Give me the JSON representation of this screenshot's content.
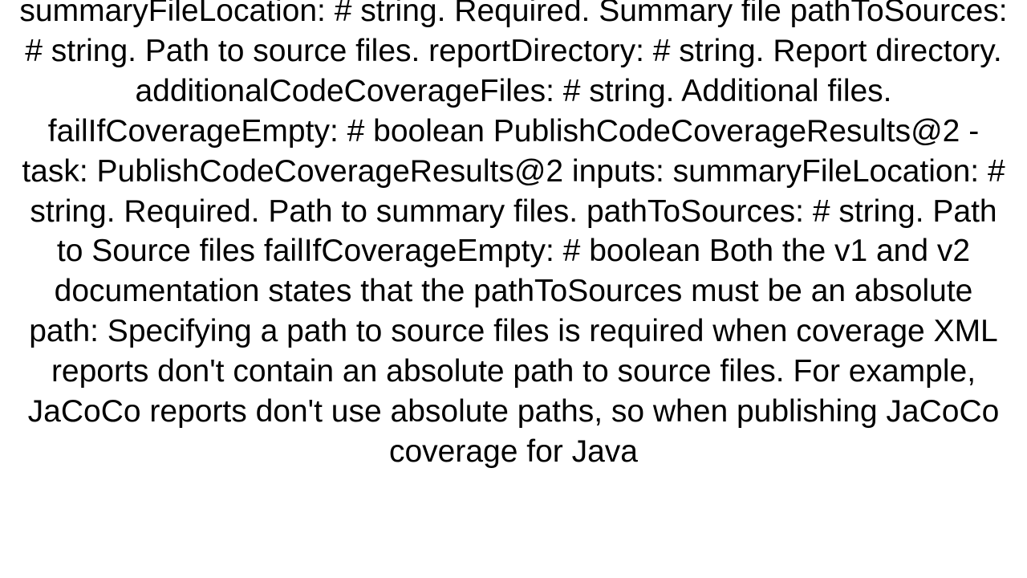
{
  "content": {
    "text": "summaryFileLocation: # string. Required. Summary file     pathToSources: # string. Path to source files.     reportDirectory: # string. Report directory.     additionalCodeCoverageFiles: # string. Additional files.     failIfCoverageEmpty: # boolean  PublishCodeCoverageResults@2 - task: PublishCodeCoverageResults@2   inputs:     summaryFileLocation: # string. Required. Path to summary files.     pathToSources: # string. Path to Source files     failIfCoverageEmpty: # boolean     Both the v1 and v2 documentation states that the pathToSources must be an absolute path:  Specifying a path to source files is required when coverage XML reports don't contain an absolute path to source files. For example, JaCoCo reports don't use absolute paths, so when publishing JaCoCo coverage for Java"
  }
}
